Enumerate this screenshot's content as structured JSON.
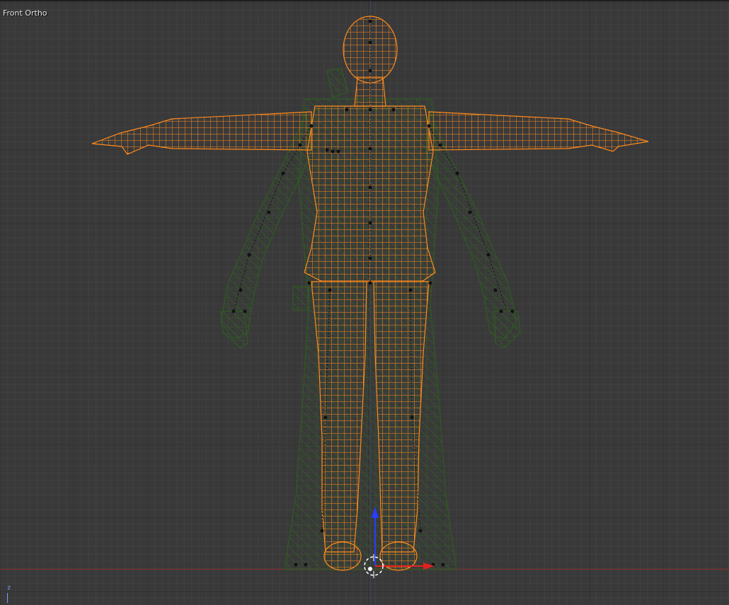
{
  "viewport": {
    "view_label": "Front Ortho",
    "background_color": "#393939",
    "grid_color": "#2d2d2d",
    "x_axis_color": "#8a2a2a",
    "z_axis_color": "#3d4f7a"
  },
  "scene": {
    "selected_mesh_color": "#ff8a1c",
    "armature_mesh_color": "#2f5a23",
    "bone_joint_color": "#111111",
    "cursor_color": "#ffffff",
    "gizmo_up_color": "#2a3cff",
    "gizmo_right_color": "#e02020"
  },
  "axis_gizmo": {
    "label": "z"
  },
  "icons": [
    "3d-cursor-icon",
    "transform-gizmo-icon",
    "axis-orientation-icon"
  ]
}
